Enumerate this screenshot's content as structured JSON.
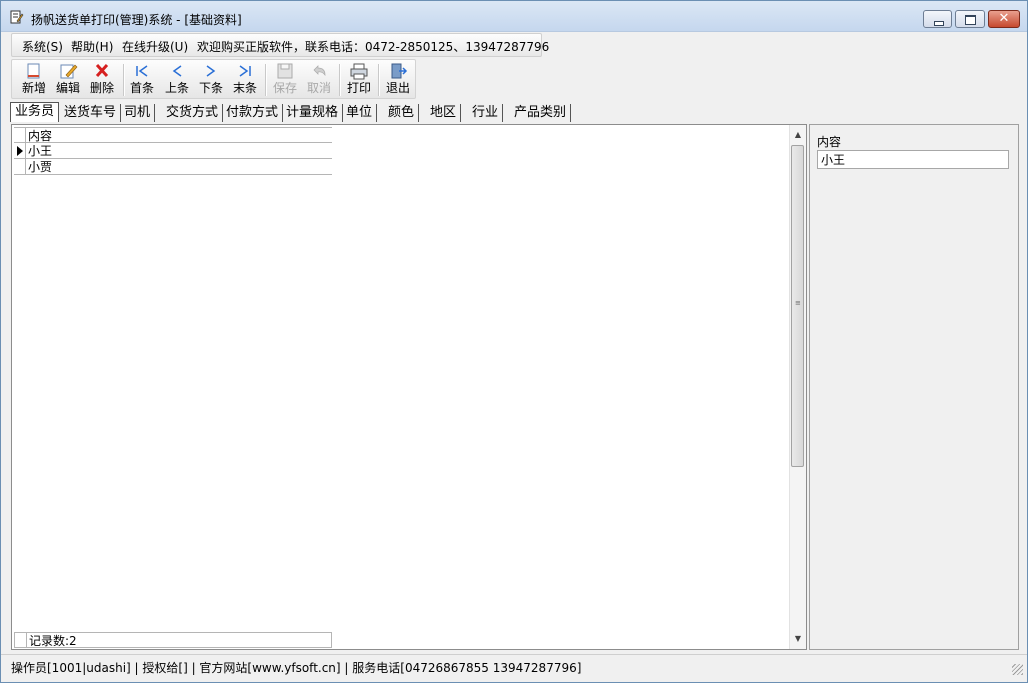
{
  "window": {
    "title": "扬帆送货单打印(管理)系统 - [基础资料]"
  },
  "menu": {
    "system": "系统(S)",
    "help": "帮助(H)",
    "upgrade": "在线升级(U)",
    "promo": "欢迎购买正版软件，联系电话：0472-2850125、13947287796"
  },
  "toolbar": {
    "new": "新增",
    "edit": "编辑",
    "delete": "删除",
    "first": "首条",
    "prev": "上条",
    "next": "下条",
    "last": "末条",
    "save": "保存",
    "cancel": "取消",
    "print": "打印",
    "exit": "退出"
  },
  "tabs": [
    "业务员",
    "送货车号",
    "司机",
    "交货方式",
    "付款方式",
    "计量规格",
    "单位",
    "颜色",
    "地区",
    "行业",
    "产品类别"
  ],
  "grid": {
    "header": "内容",
    "rows": [
      "小王",
      "小贾"
    ],
    "footer": "记录数:2"
  },
  "detail": {
    "label": "内容",
    "value": "小王"
  },
  "status": {
    "text": "操作员[1001|udashi] | 授权给[] | 官方网站[www.yfsoft.cn] | 服务电话[04726867855 13947287796]"
  },
  "colors": {
    "delete_icon": "#d62020",
    "nav_icon": "#2a6fd6"
  }
}
